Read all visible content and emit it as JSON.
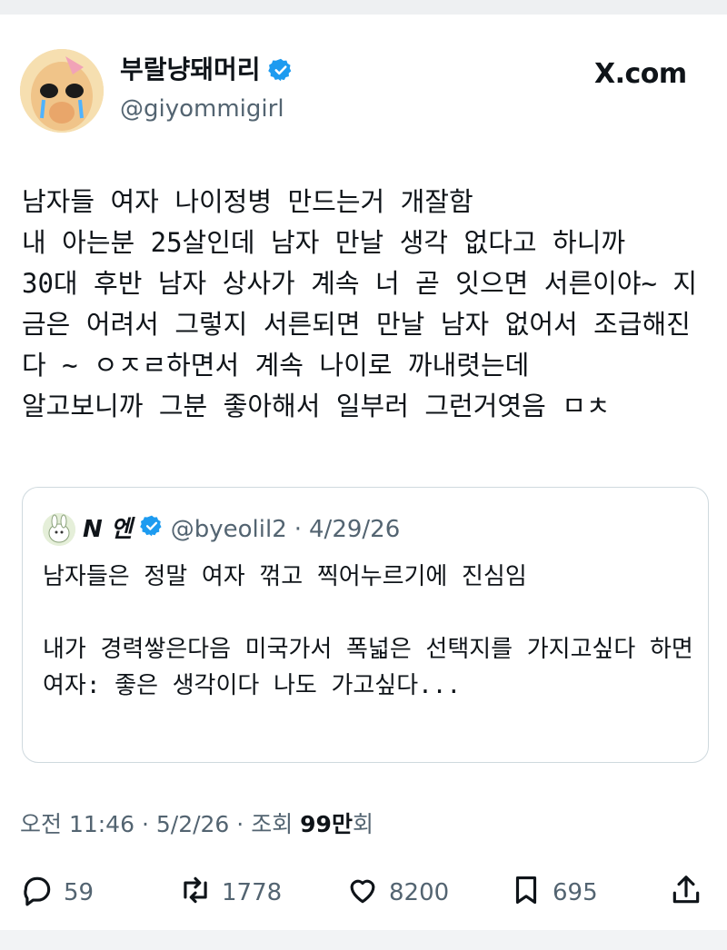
{
  "tweet": {
    "author": {
      "display_name": "부랄냥돼머리",
      "handle": "@giyommigirl",
      "verified": true
    },
    "site": "X.com",
    "text": "남자들 여자 나이정병 만드는거 개잘함\n내 아는분 25살인데 남자 만날 생각 없다고 하니까\n30대 후반 남자 상사가 계속 너 곧 잇으면 서른이야~ 지금은 어려서 그렇지 서른되면 만날 남자 없어서 조급해진다 ~ ㅇㅈㄹ하면서 계속 나이로 까내렷는데\n알고보니까 그분 좋아해서 일부러 그런거엿음 ㅁㅊ",
    "quote": {
      "author": {
        "display_name": "N 엔",
        "handle": "@byeolil2",
        "verified": true
      },
      "date": "4/29/26",
      "text": "남자들은 정말 여자 꺾고 찍어누르기에 진심임\n\n내가 경력쌓은다음 미국가서 폭넓은 선택지를 가지고싶다 하면\n여자: 좋은 생각이다 나도 가고싶다..."
    },
    "meta": {
      "time": "오전 11:46",
      "date": "5/2/26",
      "views_label": "조회",
      "views_count": "99만",
      "views_suffix": "회"
    },
    "stats": {
      "replies": "59",
      "retweets": "1778",
      "likes": "8200",
      "bookmarks": "695"
    }
  },
  "colors": {
    "verified": "#1d9bf0",
    "text": "#0f1419",
    "secondary": "#536471",
    "border": "#cfd9de"
  },
  "icons": [
    "verified-badge-icon",
    "reply-icon",
    "retweet-icon",
    "like-icon",
    "bookmark-icon",
    "share-icon"
  ]
}
